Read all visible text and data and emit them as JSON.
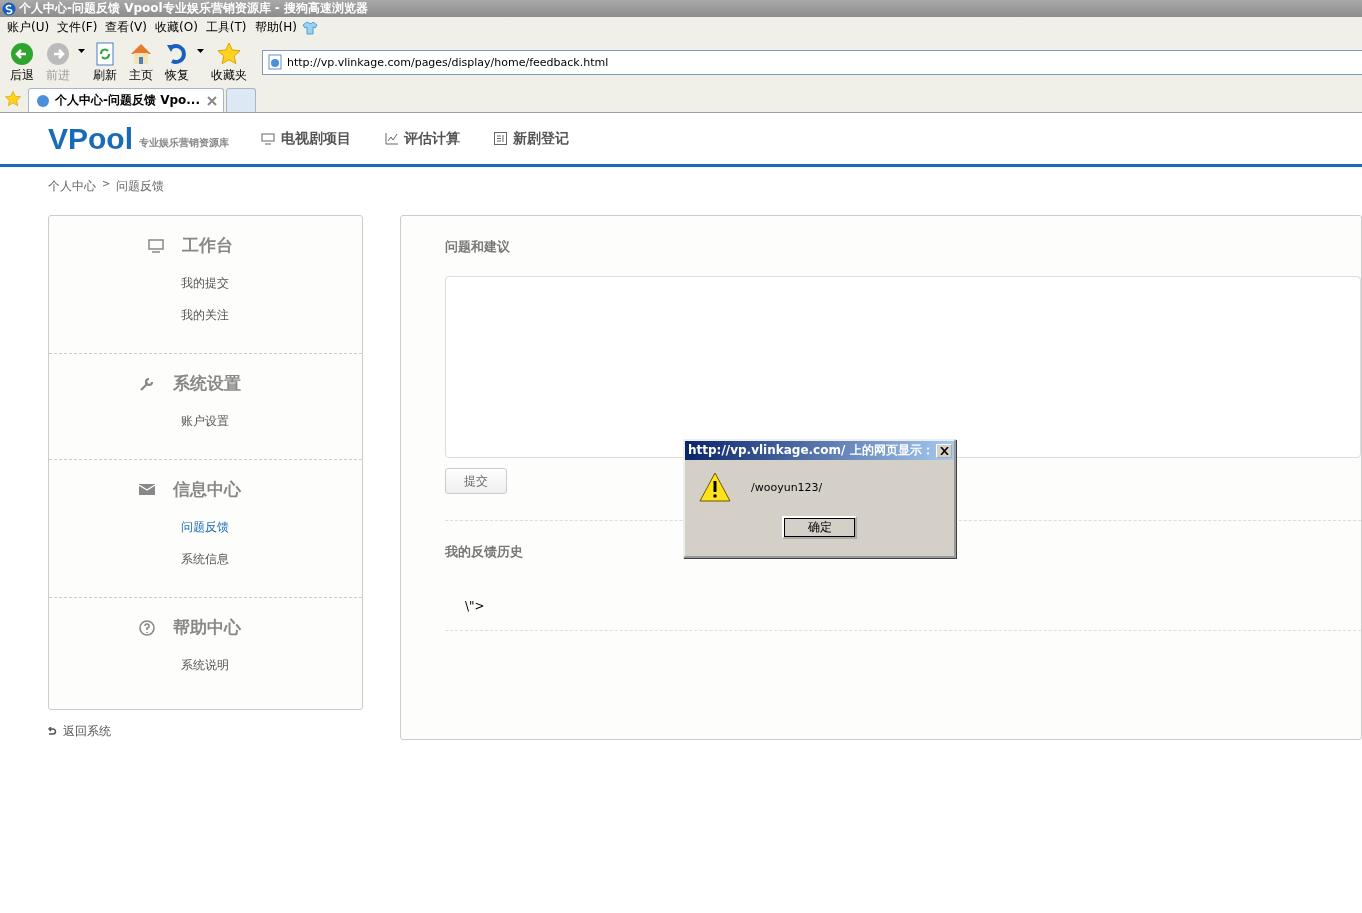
{
  "window": {
    "title": "个人中心-问题反馈 Vpool专业娱乐营销资源库 - 搜狗高速浏览器"
  },
  "menu": [
    "账户(U)",
    "文件(F)",
    "查看(V)",
    "收藏(O)",
    "工具(T)",
    "帮助(H)"
  ],
  "toolbar": [
    {
      "label": "后退",
      "disabled": false
    },
    {
      "label": "前进",
      "disabled": true
    },
    {
      "label": "刷新",
      "disabled": false
    },
    {
      "label": "主页",
      "disabled": false
    },
    {
      "label": "恢复",
      "disabled": false
    },
    {
      "label": "收藏夹",
      "disabled": false
    }
  ],
  "address": {
    "value": "http://vp.vlinkage.com/pages/display/home/feedback.html"
  },
  "tabs": [
    {
      "label": "个人中心-问题反馈 Vpo...",
      "selected": true
    }
  ],
  "site": {
    "logo": "VPool",
    "tagline": "专业娱乐营销资源库",
    "nav": [
      "电视剧项目",
      "评估计算",
      "新剧登记"
    ]
  },
  "breadcrumb": [
    "个人中心",
    ">",
    "问题反馈"
  ],
  "sidebar": {
    "groups": [
      {
        "title": "工作台",
        "items": [
          {
            "label": "我的提交",
            "selected": false
          },
          {
            "label": "我的关注",
            "selected": false
          }
        ]
      },
      {
        "title": "系统设置",
        "items": [
          {
            "label": "账户设置",
            "selected": false
          }
        ]
      },
      {
        "title": "信息中心",
        "items": [
          {
            "label": "问题反馈",
            "selected": true
          },
          {
            "label": "系统信息",
            "selected": false
          }
        ]
      },
      {
        "title": "帮助中心",
        "items": [
          {
            "label": "系统说明",
            "selected": false
          }
        ]
      }
    ],
    "back": "返回系统"
  },
  "main": {
    "form_title": "问题和建议",
    "submit": "提交",
    "history_title": "我的反馈历史",
    "history": [
      "\\\">"
    ]
  },
  "dialog": {
    "title": "http://vp.vlinkage.com/ 上的网页显示：",
    "message": "/wooyun123/",
    "ok": "确定"
  }
}
